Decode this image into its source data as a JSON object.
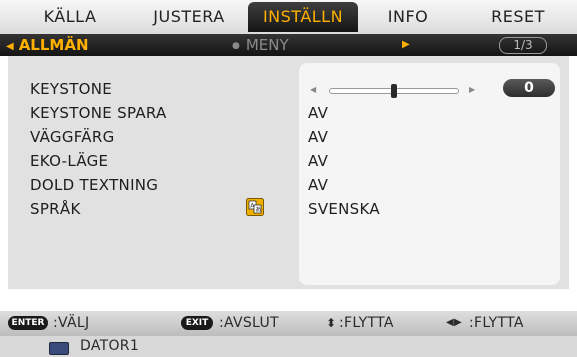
{
  "tabs": [
    "KÄLLA",
    "JUSTERA",
    "INSTÄLLN",
    "INFO",
    "RESET"
  ],
  "subheader": {
    "left": "ALLMÄN",
    "mid": "MENY",
    "page": "1/3"
  },
  "settings": [
    {
      "label": "KEYSTONE",
      "value": ""
    },
    {
      "label": "KEYSTONE SPARA",
      "value": "AV"
    },
    {
      "label": "VÄGGFÄRG",
      "value": "AV"
    },
    {
      "label": "EKO-LÄGE",
      "value": "AV"
    },
    {
      "label": "DOLD TEXTNING",
      "value": "AV"
    },
    {
      "label": "SPRÅK",
      "value": "SVENSKA"
    }
  ],
  "keystone": {
    "value": "0",
    "level": 0.5
  },
  "hints": {
    "enter_key": "ENTER",
    "enter_action": ":VÄLJ",
    "exit_key": "EXIT",
    "exit_action": ":AVSLUT",
    "updown_action": ":FLYTTA",
    "leftright_action": ":FLYTTA"
  },
  "source": "DATOR1",
  "colors": {
    "active_tab": "#ffb000",
    "selected_section": "#ffb000"
  }
}
